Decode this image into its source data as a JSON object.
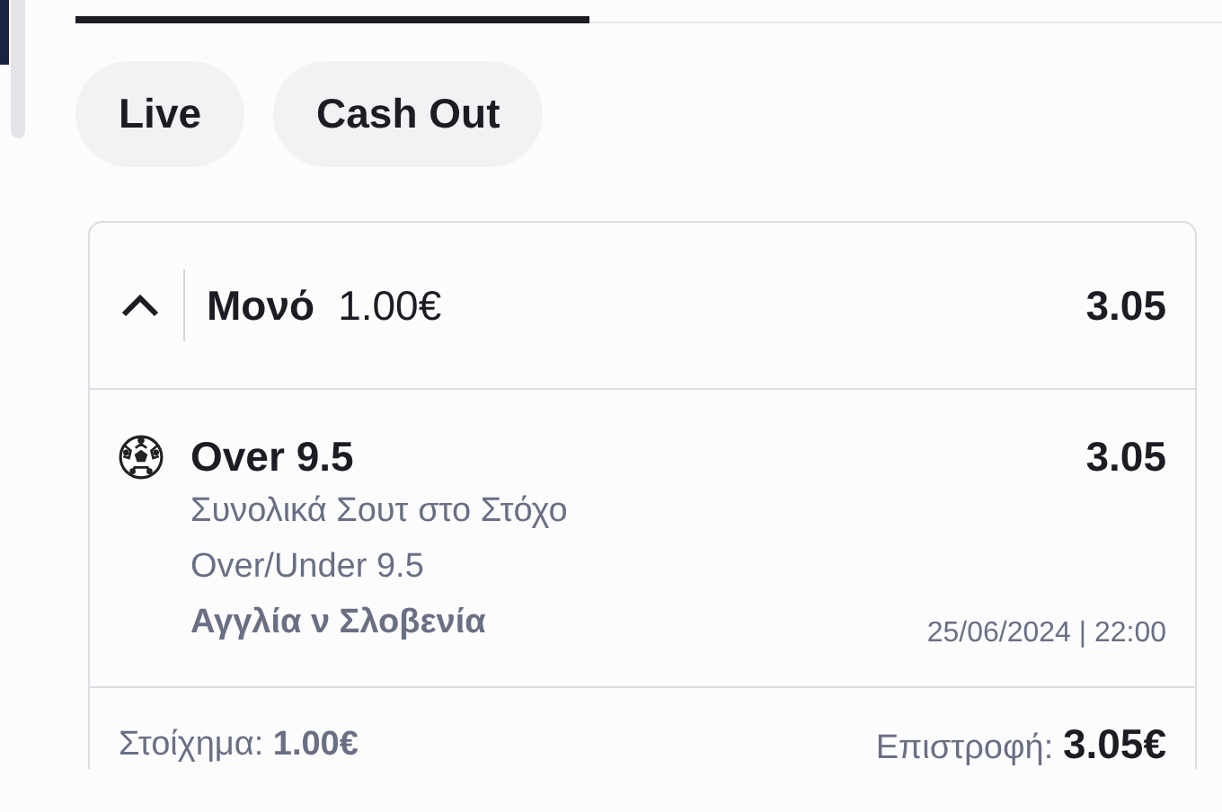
{
  "filters": [
    {
      "label": "Live"
    },
    {
      "label": "Cash Out"
    }
  ],
  "slip": {
    "expanded": true,
    "type": "Μονό",
    "stake": "1.00€",
    "odds": "3.05",
    "selection": {
      "name": "Over 9.5",
      "odds": "3.05",
      "market": "Συνολικά Σουτ στο Στόχο",
      "line": "Over/Under 9.5",
      "event": "Αγγλία ν Σλοβενία",
      "datetime": "25/06/2024 | 22:00"
    },
    "footer": {
      "stake_label": "Στοίχημα:",
      "stake": "1.00€",
      "return_label": "Επιστροφή:",
      "return": "3.05€"
    }
  }
}
